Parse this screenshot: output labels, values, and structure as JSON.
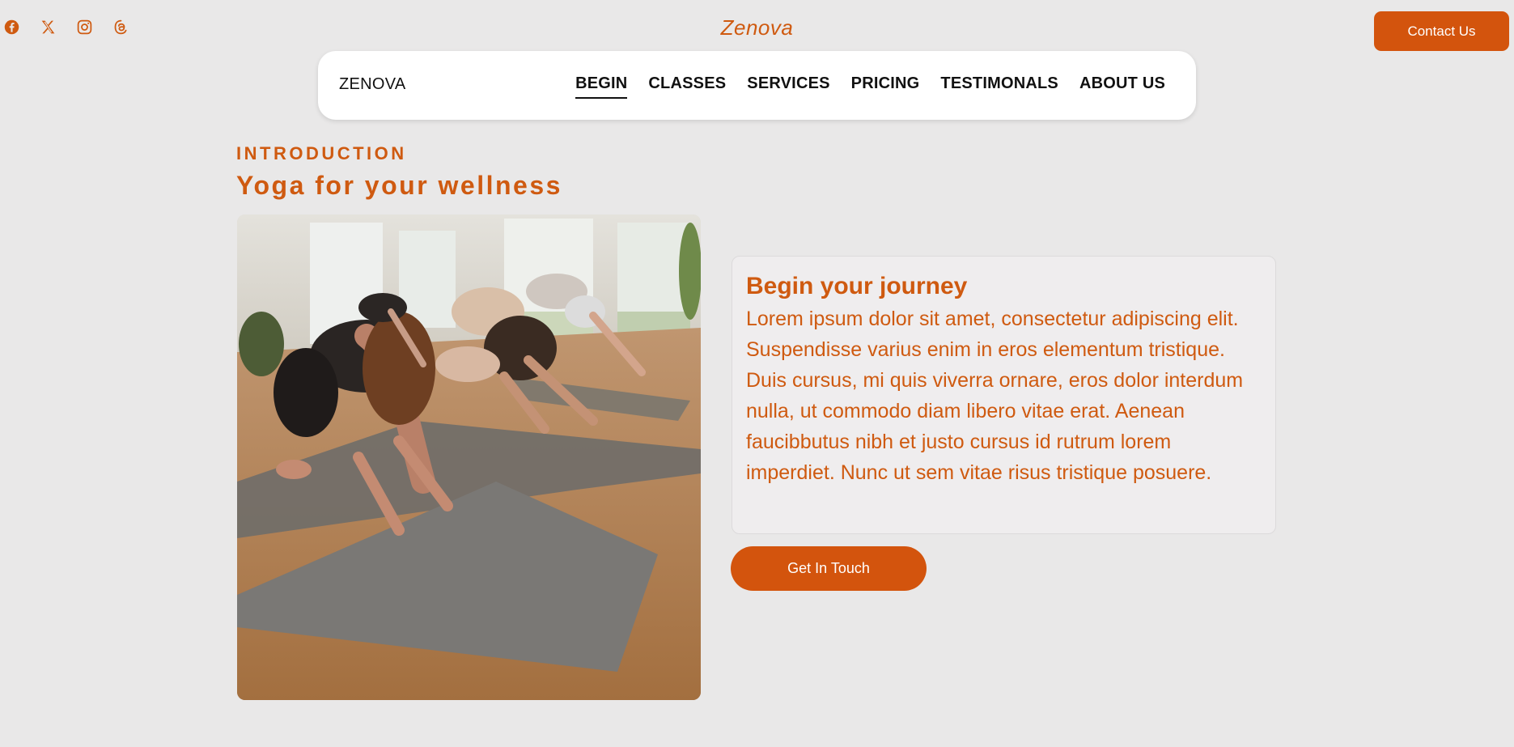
{
  "brand": {
    "script_name": "Zenova",
    "nav_logo": "ZENOVA"
  },
  "social": [
    {
      "name": "facebook-icon"
    },
    {
      "name": "x-icon"
    },
    {
      "name": "instagram-icon"
    },
    {
      "name": "threads-icon"
    }
  ],
  "header": {
    "contact_label": "Contact Us"
  },
  "nav": {
    "items": [
      {
        "label": "BEGIN",
        "active": true
      },
      {
        "label": "CLASSES"
      },
      {
        "label": "SERVICES"
      },
      {
        "label": "PRICING"
      },
      {
        "label": "TESTIMONALS"
      },
      {
        "label": "ABOUT US"
      }
    ]
  },
  "intro": {
    "eyebrow": "INTRODUCTION",
    "headline": "Yoga for your wellness"
  },
  "journey": {
    "title": "Begin your journey",
    "body": "Lorem ipsum dolor sit amet, consectetur adipiscing elit. Suspendisse varius enim in eros elementum tristique. Duis cursus, mi quis viverra ornare, eros dolor interdum nulla, ut commodo diam libero vitae erat. Aenean faucibbutus nibh et justo cursus id rutrum lorem imperdiet. Nunc ut sem vitae risus tristique posuere.",
    "cta_label": "Get In Touch"
  },
  "colors": {
    "accent": "#d3540d",
    "accent_text": "#cf5a10",
    "page_bg": "#e9e8e8"
  }
}
